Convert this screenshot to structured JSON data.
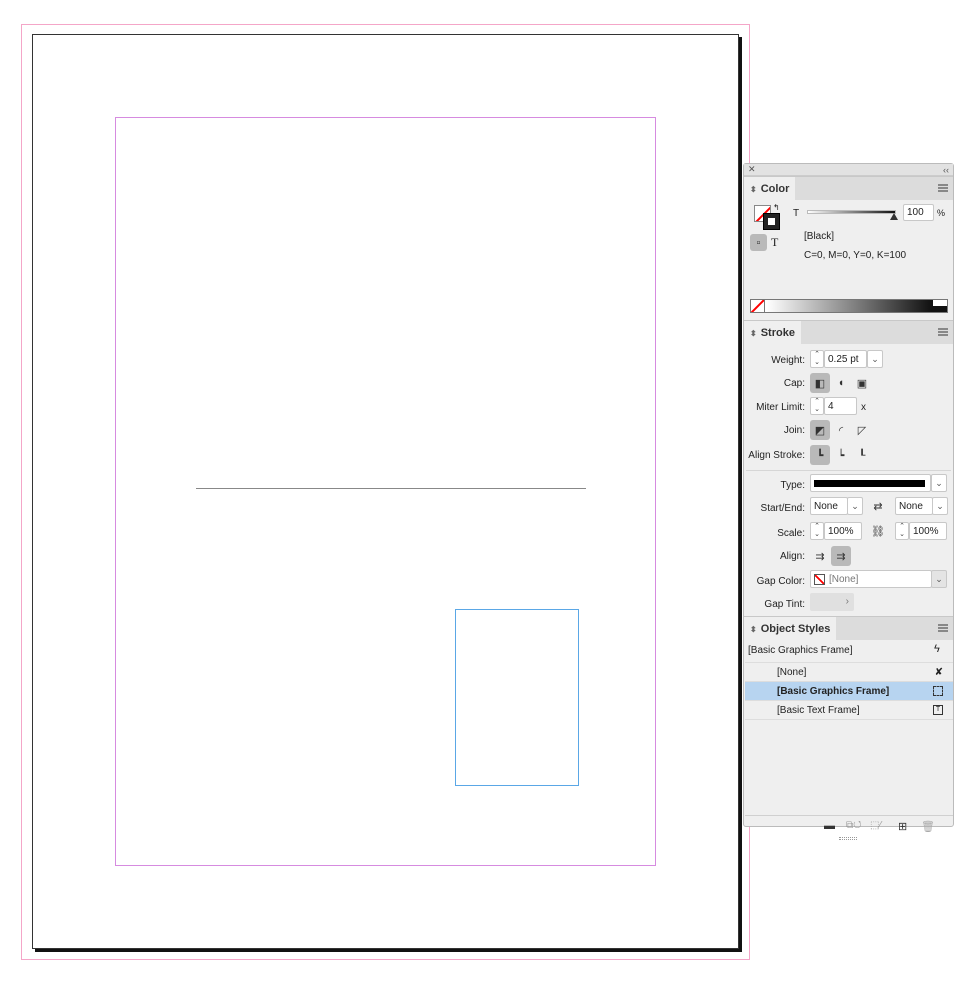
{
  "color": {
    "title": "Color",
    "tint_label": "T",
    "tint_value": "100",
    "percent": "%",
    "swatch_name": "[Black]",
    "cmyk": "C=0, M=0, Y=0, K=100",
    "text_mode": "T"
  },
  "stroke": {
    "title": "Stroke",
    "weight_label": "Weight:",
    "weight_value": "0.25 pt",
    "cap_label": "Cap:",
    "miter_label": "Miter Limit:",
    "miter_value": "4",
    "miter_unit": "x",
    "join_label": "Join:",
    "align_stroke_label": "Align Stroke:",
    "type_label": "Type:",
    "start_end_label": "Start/End:",
    "start_value": "None",
    "end_value": "None",
    "scale_label": "Scale:",
    "scale_start": "100%",
    "scale_end": "100%",
    "align_label": "Align:",
    "gap_color_label": "Gap Color:",
    "gap_color_value": "[None]",
    "gap_tint_label": "Gap Tint:"
  },
  "object_styles": {
    "title": "Object Styles",
    "current": "[Basic Graphics Frame]",
    "items": [
      {
        "label": "[None]",
        "selected": false
      },
      {
        "label": "[Basic Graphics Frame]",
        "selected": true
      },
      {
        "label": "[Basic Text Frame]",
        "selected": false
      }
    ]
  }
}
